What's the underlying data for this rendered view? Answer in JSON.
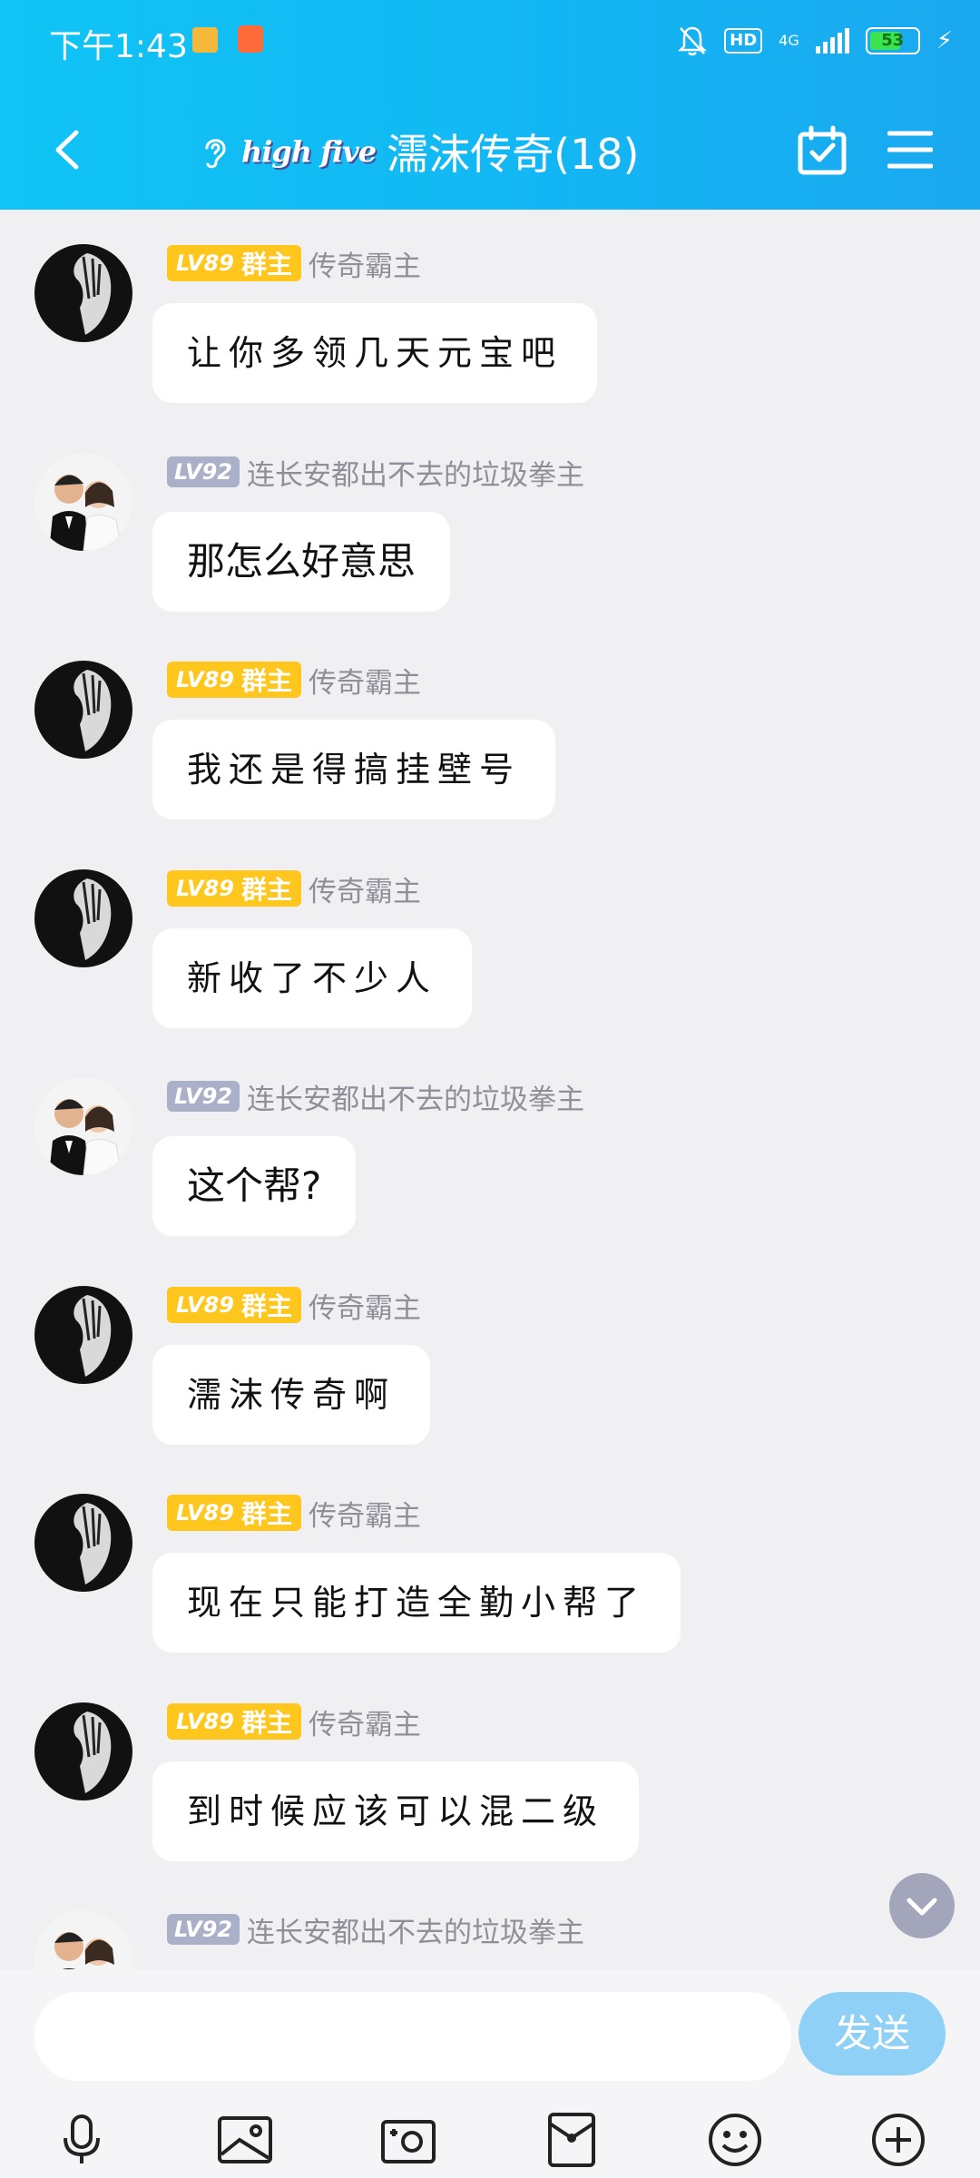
{
  "status_bar": {
    "time": "下午1:43",
    "hd": "HD",
    "network": "4G",
    "battery": "53",
    "battery_level": 0.53
  },
  "header": {
    "logo_text": "high five",
    "title": "濡沫传奇(18)"
  },
  "messages": [
    {
      "level": "LV89",
      "role": "群主",
      "sender": "传奇霸主",
      "text": "让你多领几天元宝吧",
      "avatar": "dark"
    },
    {
      "level": "LV92",
      "role": "",
      "sender": "连长安都出不去的垃圾拳主",
      "text": "那怎么好意思",
      "avatar": "couple"
    },
    {
      "level": "LV89",
      "role": "群主",
      "sender": "传奇霸主",
      "text": "我还是得搞挂壁号",
      "avatar": "dark"
    },
    {
      "level": "LV89",
      "role": "群主",
      "sender": "传奇霸主",
      "text": "新收了不少人",
      "avatar": "dark"
    },
    {
      "level": "LV92",
      "role": "",
      "sender": "连长安都出不去的垃圾拳主",
      "text": "这个帮?",
      "avatar": "couple"
    },
    {
      "level": "LV89",
      "role": "群主",
      "sender": "传奇霸主",
      "text": "濡沫传奇啊",
      "avatar": "dark"
    },
    {
      "level": "LV89",
      "role": "群主",
      "sender": "传奇霸主",
      "text": "现在只能打造全勤小帮了",
      "avatar": "dark"
    },
    {
      "level": "LV89",
      "role": "群主",
      "sender": "传奇霸主",
      "text": "到时候应该可以混二级",
      "avatar": "dark"
    },
    {
      "level": "LV92",
      "role": "",
      "sender": "连长安都出不去的垃圾拳主",
      "text": "",
      "avatar": "couple"
    }
  ],
  "input": {
    "placeholder": "",
    "send_label": "发送"
  },
  "toolbar": {
    "icons": [
      "microphone-icon",
      "image-icon",
      "camera-icon",
      "red-packet-icon",
      "emoji-icon",
      "plus-icon"
    ]
  },
  "colors": {
    "header_start": "#10c4f5",
    "header_end": "#1aa8f0",
    "owner_badge": "#ffc61e",
    "member_badge": "#aab0c8",
    "send_button": "#8fd0f7"
  }
}
